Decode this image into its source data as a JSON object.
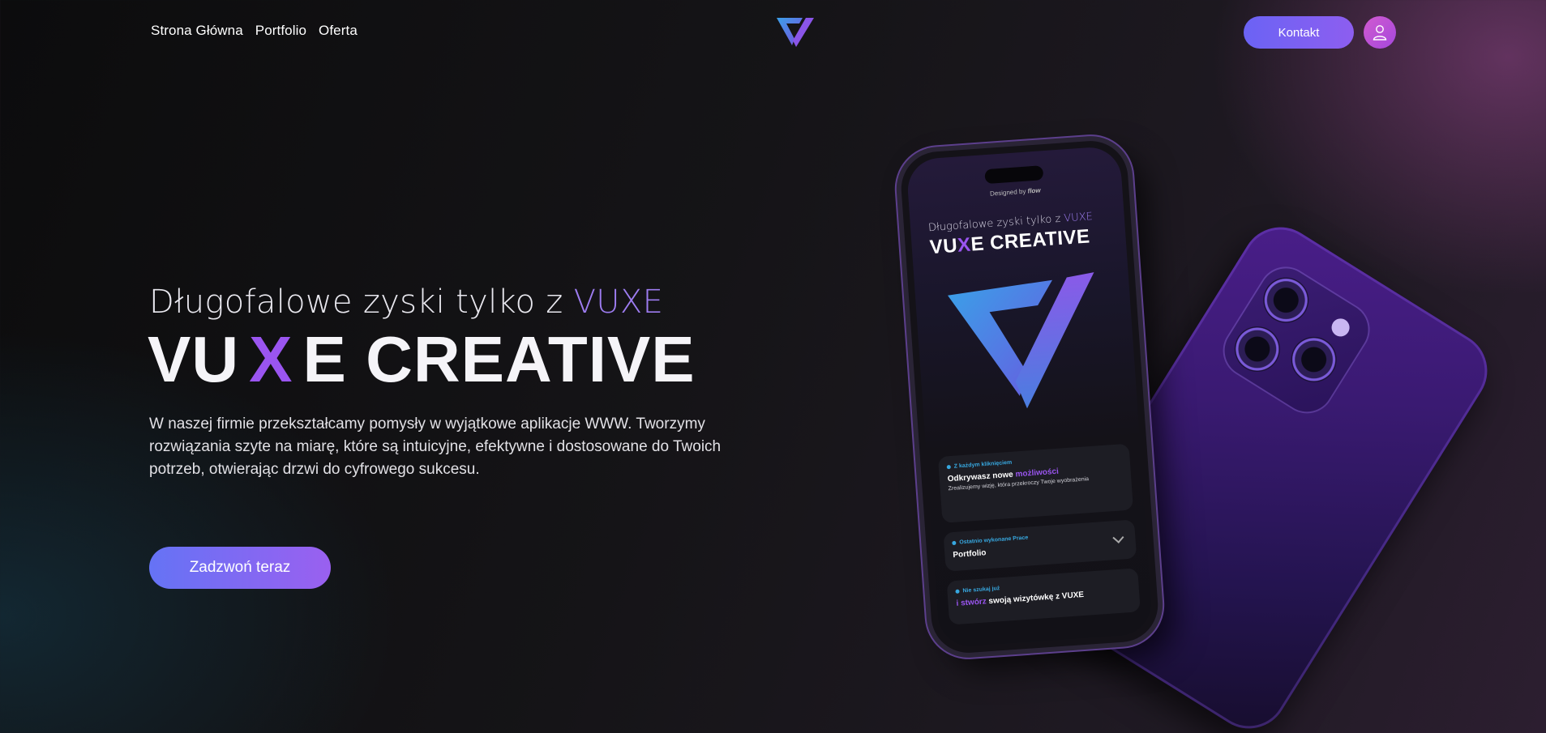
{
  "nav": {
    "links": [
      "Strona Główna",
      "Portfolio",
      "Oferta"
    ],
    "contact_label": "Kontakt",
    "user_icon": "user-icon",
    "logo_icon": "vuxe-logo"
  },
  "hero": {
    "tagline_prefix": "Długofalowe zyski tylko z ",
    "tagline_accent": "VUXE",
    "brand_part1": "VU",
    "brand_x": "X",
    "brand_part2": "E CREATIVE",
    "description": "W naszej firmie przekształcamy pomysły w wyjątkowe aplikacje WWW. Tworzymy rozwiązania szyte na miarę, które są intuicyjne, efektywne i dostosowane do Twoich potrzeb, otwierając drzwi do cyfrowego sukcesu.",
    "cta_label": "Zadzwoń teraz"
  },
  "phone_screen": {
    "designed_by_prefix": "Designed by ",
    "designed_by_name": "flow",
    "tagline_prefix": "Długofalowe zyski tylko z ",
    "tagline_accent": "VUXE",
    "brand_part1": "VU",
    "brand_x": "X",
    "brand_part2": "E CREATIVE",
    "cards": [
      {
        "tag": "Z każdym kliknięciem",
        "title_prefix": "Odkrywasz nowe ",
        "title_highlight": "możliwości",
        "subtitle": "Zrealizujemy wizję, która przekroczy Twoje wyobrażenia"
      },
      {
        "tag": "Ostatnio wykonane Prace",
        "title": "Portfolio"
      },
      {
        "tag": "Nie szukaj już",
        "title_highlight": "i stwórz",
        "title_rest": " swoją wizytówkę z VUXE"
      }
    ]
  },
  "colors": {
    "accent_purple": "#9a55f0",
    "accent_blue": "#6573f5",
    "tag_blue": "#37a8e0"
  }
}
